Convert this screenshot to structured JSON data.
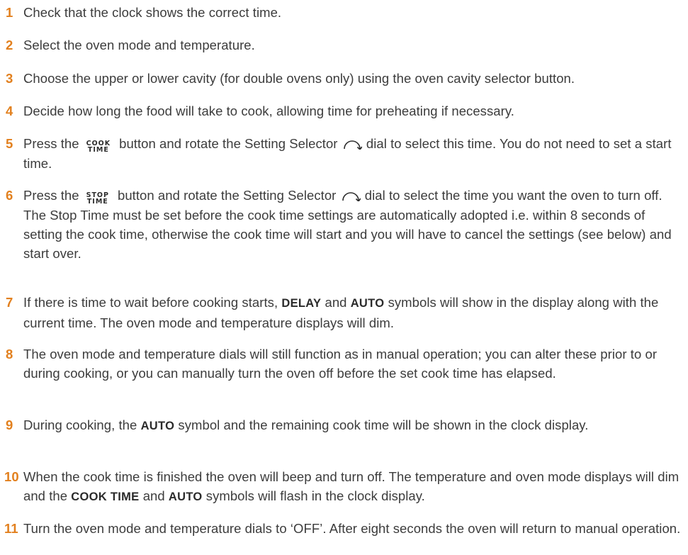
{
  "steps": [
    {
      "num": "1",
      "text": "Check that the clock shows the correct time."
    },
    {
      "num": "2",
      "text": "Select the oven mode and temperature."
    },
    {
      "num": "3",
      "text": "Choose the upper or lower cavity (for double ovens only) using the oven cavity selector button."
    },
    {
      "num": "4",
      "text": "Decide how long the food will take to cook, allowing time for preheating if necessary."
    },
    {
      "num": "5",
      "pre": "Press the",
      "button_top": "COOK",
      "button_bottom": "TIME",
      "mid": "button and rotate the Setting Selector",
      "post": "dial to select this time. You do not need to set a start time."
    },
    {
      "num": "6",
      "pre": "Press the",
      "button_top": "STOP",
      "button_bottom": "TIME",
      "mid": "button and rotate the Setting Selector",
      "post": "dial to select the time you want the oven to turn off.  The Stop Time must be set before the cook time settings are automatically adopted i.e. within 8 seconds of setting the cook time, otherwise the cook time will start and you will have to cancel the settings (see below) and start over."
    },
    {
      "num": "7",
      "a": "If there is time to wait before cooking starts,",
      "kw1": "DELAY",
      "b": "and",
      "kw2": "AUTO",
      "c": "symbols will show in the display along with the current time.  The oven mode and temperature displays will dim."
    },
    {
      "num": "8",
      "text": "The oven mode and temperature dials will still function as in manual operation; you can alter these prior to or during cooking, or you can manually turn the oven off before the set cook time has elapsed."
    },
    {
      "num": "9",
      "a": "During cooking, the",
      "kw1": "AUTO",
      "b": "symbol and the remaining cook time will be shown in the clock display."
    },
    {
      "num": "10",
      "a": "When the cook time is finished the oven will beep and turn off.  The temperature and oven mode displays will dim and the",
      "kw1": "COOK TIME",
      "b": "and",
      "kw2": "AUTO",
      "c": "symbols will flash in the clock display."
    },
    {
      "num": "11",
      "text": "Turn the oven mode and temperature dials to ‘OFF’.  After eight seconds the oven will return to manual operation."
    }
  ],
  "icons": {
    "dial": "rotate-dial-icon"
  },
  "colors": {
    "step_number": "#e2801e",
    "body_text": "#3c3c3c"
  }
}
